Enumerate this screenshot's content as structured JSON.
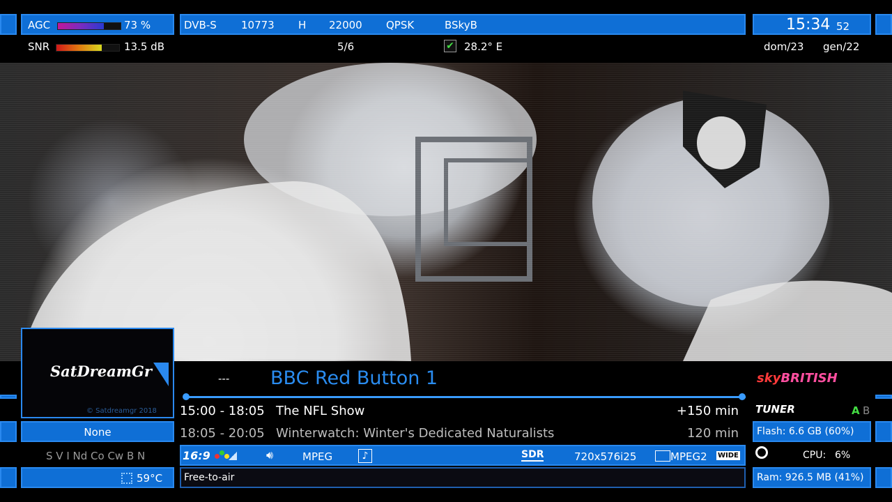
{
  "signal": {
    "agc_label": "AGC",
    "agc_value": "73 %",
    "agc_level": 0.73,
    "snr_label": "SNR",
    "snr_value": "13.5 dB",
    "snr_level": 0.72
  },
  "transponder": {
    "system": "DVB-S",
    "frequency": "10773",
    "polarization": "H",
    "symbol_rate": "22000",
    "modulation": "QPSK",
    "provider": "BSkyB",
    "fec": "5/6",
    "orbital_position": "28.2° E"
  },
  "clock": {
    "time": "15:34",
    "seconds": "52",
    "date_day": "dom/23",
    "date_month": "gen/22"
  },
  "skin_logo": {
    "name": "SatDreamGr",
    "copyright": "© Satdreamgr 2018"
  },
  "channel": {
    "number": "---",
    "name": "BBC Red Button 1",
    "progress": 0.0
  },
  "epg": [
    {
      "time": "15:00 - 18:05",
      "title": "The NFL Show",
      "duration": "+150 min"
    },
    {
      "time": "18:05 - 20:05",
      "title": "Winterwatch: Winter's Dedicated Naturalists",
      "duration": "120 min"
    }
  ],
  "left_panel": {
    "crypt": "None",
    "caids": "S V I Nd Co Cw B N",
    "temperature": "59°C"
  },
  "info_bar": {
    "aspect": "16:9",
    "audio_codec": "MPEG",
    "sdr": "SDR",
    "resolution": "720x576i25",
    "video_codec": "MPEG2",
    "wide": "WIDE",
    "access": "Free-to-air"
  },
  "right_panel": {
    "network_logo_sky": "sky",
    "network_logo_text": "BRITISH",
    "tuner_label": "TUNER",
    "tuner_a": "A",
    "tuner_b": "B",
    "flash": "Flash: 6.6 GB (60%)",
    "cpu_label": "CPU:",
    "cpu_value": "6%",
    "ram": "Ram: 926.5 MB (41%)"
  },
  "colors": {
    "bar_blue": "#0f6fd6",
    "accent_green": "#44dd44",
    "title_blue": "#2a8cf0"
  }
}
